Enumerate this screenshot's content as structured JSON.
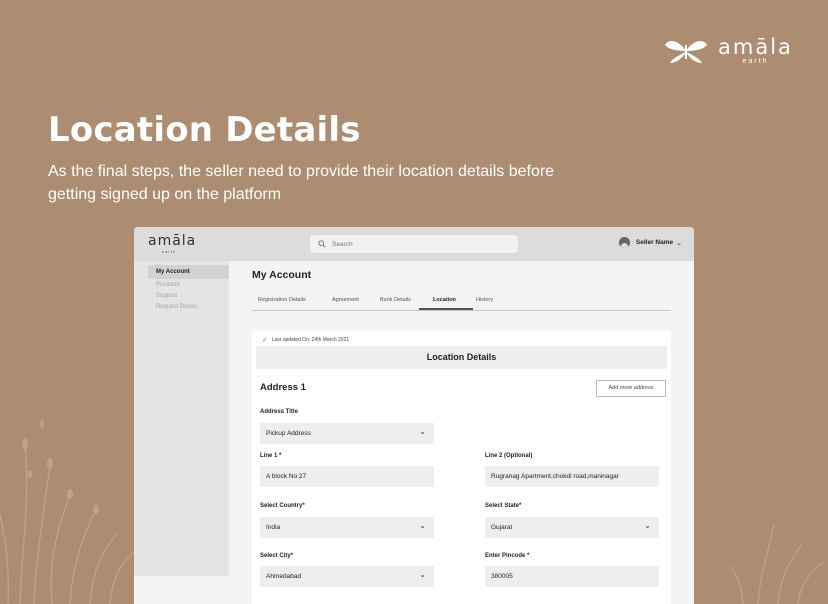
{
  "brand": {
    "name": "amāla",
    "sub": "earth"
  },
  "hero": {
    "title": "Location Details",
    "description": "As the final steps, the seller need to provide their location details before getting signed up on the platform"
  },
  "app": {
    "logo_name": "amāla",
    "logo_sub": "earth",
    "search_placeholder": "Search",
    "user_name": "Seller Name",
    "sidebar": [
      {
        "label": "My Account",
        "active": true
      },
      {
        "label": "Products",
        "active": false
      },
      {
        "label": "Support",
        "active": false
      },
      {
        "label": "Request Boxes",
        "active": false
      }
    ],
    "page_title": "My Account",
    "tabs": [
      {
        "label": "Registration Details"
      },
      {
        "label": "Agreement"
      },
      {
        "label": "Bank Details"
      },
      {
        "label": "Location",
        "active": true
      },
      {
        "label": "History"
      }
    ]
  },
  "form": {
    "last_updated": "Last updated On: 24th March 2021",
    "section_title": "Location Details",
    "address_title": "Address 1",
    "add_more_label": "Add more address",
    "address_type": {
      "label": "Address Title",
      "value": "Pickup Address"
    },
    "line1": {
      "label": "Line 1 *",
      "value": "A block No 27"
    },
    "line2": {
      "label": "Line 2 (Optional)",
      "value": "Rugranag Apartment,chokdi road,maninagar"
    },
    "country": {
      "label": "Select Country*",
      "value": "India"
    },
    "state": {
      "label": "Select State*",
      "value": "Gujarat"
    },
    "city": {
      "label": "Select City*",
      "value": "Ahmedabad"
    },
    "pincode": {
      "label": "Enter Pincode *",
      "value": "380005"
    }
  },
  "colors": {
    "background": "#ad8d71",
    "success_check": "#4c9a3b"
  }
}
